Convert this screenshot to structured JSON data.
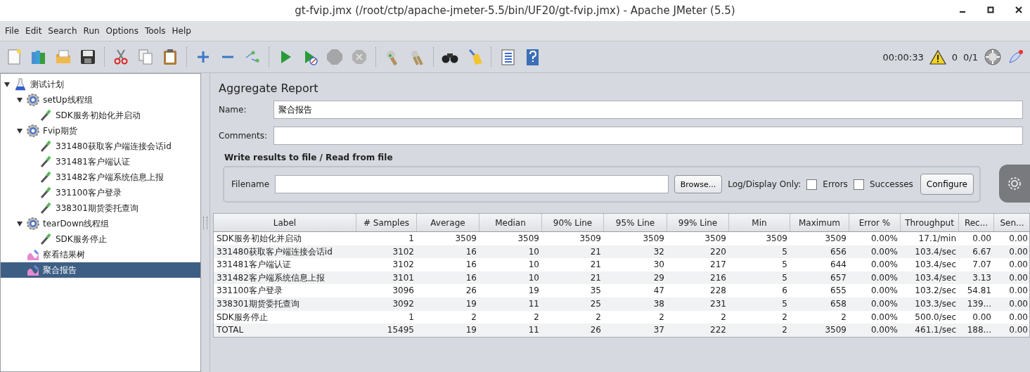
{
  "window": {
    "title": "gt-fvip.jmx (/root/ctp/apache-jmeter-5.5/bin/UF20/gt-fvip.jmx) - Apache JMeter (5.5)"
  },
  "menu": [
    {
      "label": "File"
    },
    {
      "label": "Edit"
    },
    {
      "label": "Search"
    },
    {
      "label": "Run"
    },
    {
      "label": "Options"
    },
    {
      "label": "Tools"
    },
    {
      "label": "Help"
    }
  ],
  "toolbar": [
    {
      "kind": "new",
      "disabled": false
    },
    {
      "kind": "templates",
      "disabled": false
    },
    {
      "kind": "open",
      "disabled": false
    },
    {
      "kind": "save",
      "disabled": false
    },
    {
      "kind": "separator"
    },
    {
      "kind": "cut",
      "disabled": false
    },
    {
      "kind": "copy",
      "disabled": false
    },
    {
      "kind": "paste",
      "disabled": false
    },
    {
      "kind": "separator"
    },
    {
      "kind": "expand",
      "disabled": false
    },
    {
      "kind": "collapse",
      "disabled": false
    },
    {
      "kind": "toggle",
      "disabled": false
    },
    {
      "kind": "separator"
    },
    {
      "kind": "start",
      "disabled": false
    },
    {
      "kind": "start-no-pause",
      "disabled": false
    },
    {
      "kind": "stop",
      "disabled": true
    },
    {
      "kind": "shutdown",
      "disabled": true
    },
    {
      "kind": "separator"
    },
    {
      "kind": "clear",
      "disabled": false
    },
    {
      "kind": "clear-all",
      "disabled": false
    },
    {
      "kind": "separator"
    },
    {
      "kind": "search",
      "disabled": false
    },
    {
      "kind": "reset-search",
      "disabled": false
    },
    {
      "kind": "separator"
    },
    {
      "kind": "functions",
      "disabled": false
    },
    {
      "kind": "help",
      "disabled": false
    }
  ],
  "status": {
    "elapsed": "00:00:33",
    "warnings": "0",
    "threads": "0/1"
  },
  "tree": [
    {
      "label": "测试计划",
      "kind": "plan",
      "expanded": true,
      "selected": false,
      "children": [
        {
          "label": "setUp线程组",
          "kind": "thread-group",
          "expanded": true,
          "selected": false,
          "children": [
            {
              "label": "SDK服务初始化并启动",
              "kind": "sampler",
              "selected": false
            }
          ]
        },
        {
          "label": "Fvip期货",
          "kind": "thread-group",
          "expanded": true,
          "selected": false,
          "children": [
            {
              "label": "331480获取客户端连接会话id",
              "kind": "sampler",
              "selected": false
            },
            {
              "label": "331481客户端认证",
              "kind": "sampler",
              "selected": false
            },
            {
              "label": "331482客户端系统信息上报",
              "kind": "sampler",
              "selected": false
            },
            {
              "label": "331100客户登录",
              "kind": "sampler",
              "selected": false
            },
            {
              "label": "338301期货委托查询",
              "kind": "sampler",
              "selected": false
            }
          ]
        },
        {
          "label": "tearDown线程组",
          "kind": "thread-group",
          "expanded": true,
          "selected": false,
          "children": [
            {
              "label": "SDK服务停止",
              "kind": "sampler",
              "selected": false
            }
          ]
        },
        {
          "label": "察看结果树",
          "kind": "listener",
          "selected": false
        },
        {
          "label": "聚合报告",
          "kind": "listener",
          "selected": true
        }
      ]
    }
  ],
  "panel": {
    "title": "Aggregate Report",
    "name_label": "Name:",
    "name_value": "聚合报告",
    "comments_label": "Comments:",
    "file_section": "Write results to file / Read from file",
    "filename_label": "Filename",
    "browse": "Browse...",
    "log_label": "Log/Display Only:",
    "checkboxes": [
      {
        "label": "Errors",
        "checked": false
      },
      {
        "label": "Successes",
        "checked": false
      }
    ],
    "configure": "Configure"
  },
  "table": {
    "columns": [
      "Label",
      "# Samples",
      "Average",
      "Median",
      "90% Line",
      "95% Line",
      "99% Line",
      "Min",
      "Maximum",
      "Error %",
      "Throughput",
      "Rec...",
      "Sen..."
    ],
    "rows": [
      [
        "SDK服务初始化并启动",
        "1",
        "3509",
        "3509",
        "3509",
        "3509",
        "3509",
        "3509",
        "3509",
        "0.00%",
        "17.1/min",
        "0.00",
        "0.00"
      ],
      [
        "331480获取客户端连接会话id",
        "3102",
        "16",
        "10",
        "21",
        "32",
        "220",
        "5",
        "656",
        "0.00%",
        "103.4/sec",
        "6.67",
        "0.00"
      ],
      [
        "331481客户端认证",
        "3102",
        "16",
        "10",
        "21",
        "30",
        "217",
        "5",
        "644",
        "0.00%",
        "103.4/sec",
        "7.07",
        "0.00"
      ],
      [
        "331482客户端系统信息上报",
        "3101",
        "16",
        "10",
        "21",
        "29",
        "216",
        "5",
        "657",
        "0.00%",
        "103.4/sec",
        "3.13",
        "0.00"
      ],
      [
        "331100客户登录",
        "3096",
        "26",
        "19",
        "35",
        "47",
        "228",
        "6",
        "655",
        "0.00%",
        "103.2/sec",
        "54.81",
        "0.00"
      ],
      [
        "338301期货委托查询",
        "3092",
        "19",
        "11",
        "25",
        "38",
        "231",
        "5",
        "658",
        "0.00%",
        "103.3/sec",
        "139...",
        "0.00"
      ],
      [
        "SDK服务停止",
        "1",
        "2",
        "2",
        "2",
        "2",
        "2",
        "2",
        "2",
        "0.00%",
        "500.0/sec",
        "0.00",
        "0.00"
      ],
      [
        "TOTAL",
        "15495",
        "19",
        "11",
        "26",
        "37",
        "222",
        "2",
        "3509",
        "0.00%",
        "461.1/sec",
        "188...",
        "0.00"
      ]
    ]
  }
}
